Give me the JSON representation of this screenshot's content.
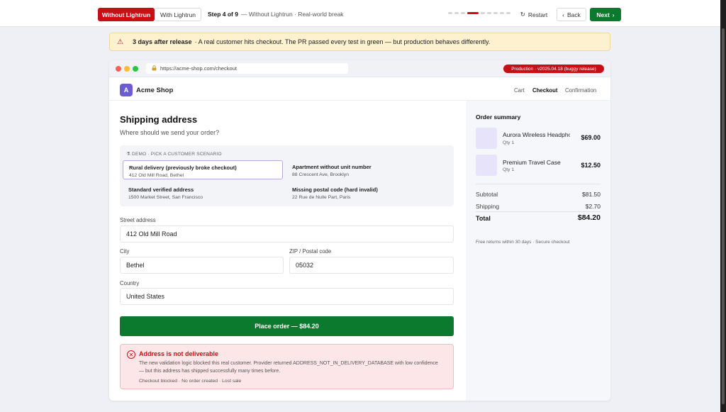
{
  "toolbar": {
    "mode_without": "Without Lightrun",
    "mode_with": "With Lightrun",
    "step_label": "Step 4 of 9",
    "step_desc": "— Without Lightrun · Real-world break",
    "total_steps": 9,
    "current_step": 4,
    "restart": "Restart",
    "back": "Back",
    "next": "Next",
    "accent_color": "#c80f16",
    "next_color": "#0b7a2e"
  },
  "banner": {
    "bold": "3 days after release",
    "text": "· A real customer hits checkout. The PR passed every test in green — but production behaves differently."
  },
  "browser": {
    "url": "https://acme-shop.com/checkout",
    "env_badge": "Production · v2025.04.18 (buggy release)"
  },
  "shop": {
    "logo_letter": "A",
    "name": "Acme Shop",
    "nav": [
      "Cart",
      "Checkout",
      "Confirmation"
    ],
    "nav_current": "Checkout"
  },
  "form": {
    "title": "Shipping address",
    "subtitle": "Where should we send your order?",
    "demo_label": "DEMO · PICK A CUSTOMER SCENARIO",
    "scenarios": [
      {
        "title": "Rural delivery (previously broke checkout)",
        "detail": "412 Old Mill Road, Bethel",
        "selected": true
      },
      {
        "title": "Apartment without unit number",
        "detail": "88 Crescent Ave, Brooklyn",
        "selected": false
      },
      {
        "title": "Standard verified address",
        "detail": "1500 Market Street, San Francisco",
        "selected": false
      },
      {
        "title": "Missing postal code (hard invalid)",
        "detail": "22 Rue de Nulle Part, Paris",
        "selected": false
      }
    ],
    "street_label": "Street address",
    "street_value": "412 Old Mill Road",
    "city_label": "City",
    "city_value": "Bethel",
    "zip_label": "ZIP / Postal code",
    "zip_value": "05032",
    "country_label": "Country",
    "country_value": "United States",
    "place_order": "Place order — $84.20"
  },
  "error": {
    "title": "Address is not deliverable",
    "body": "The new validation logic blocked this real customer. Provider returned ADDRESS_NOT_IN_DELIVERY_DATABASE with low confidence — but this address has shipped successfully many times before.",
    "footer": "Checkout blocked · No order created · Lost sale"
  },
  "summary": {
    "title": "Order summary",
    "items": [
      {
        "name": "Aurora Wireless Headphones",
        "qty": "Qty 1",
        "price": "$69.00"
      },
      {
        "name": "Premium Travel Case",
        "qty": "Qty 1",
        "price": "$12.50"
      }
    ],
    "subtotal_label": "Subtotal",
    "subtotal": "$81.50",
    "shipping_label": "Shipping",
    "shipping": "$2.70",
    "total_label": "Total",
    "total": "$84.20",
    "footnote": "Free returns within 30 days · Secure checkout"
  }
}
